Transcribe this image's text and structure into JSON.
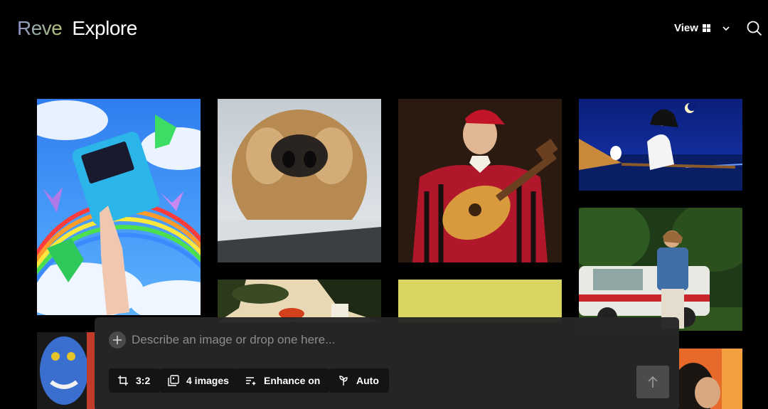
{
  "header": {
    "brand": "Reve",
    "page_title": "Explore",
    "view_label": "View",
    "view_icon": "grid-icon",
    "search_icon": "search-icon"
  },
  "gallery": {
    "tiles": [
      {
        "name": "gallery-image-gameboy-rainbow"
      },
      {
        "name": "gallery-image-dog-nose-window"
      },
      {
        "name": "gallery-image-lute-player"
      },
      {
        "name": "gallery-image-witch-broom-night"
      },
      {
        "name": "gallery-image-man-vintage-car"
      },
      {
        "name": "gallery-image-jungle-painting"
      },
      {
        "name": "gallery-image-yellow-canvas"
      },
      {
        "name": "gallery-image-blue-face-portrait"
      },
      {
        "name": "gallery-image-portrait-orange"
      }
    ]
  },
  "composer": {
    "placeholder": "Describe an image or drop one here...",
    "input_value": "",
    "aspect_ratio": "3:2",
    "image_count": "4 images",
    "enhance": "Enhance on",
    "style": "Auto",
    "add_icon": "plus-icon",
    "send_icon": "arrow-up-icon"
  },
  "colors": {
    "background": "#000000",
    "composer_bg": "#262626",
    "chip_bg": "#141414",
    "send_bg": "#4b4b4b"
  }
}
